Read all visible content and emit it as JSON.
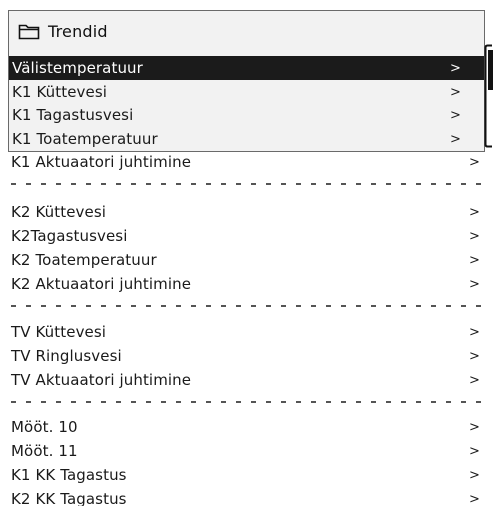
{
  "window": {
    "title": "Trendid",
    "icon": "folder-icon"
  },
  "menu": [
    {
      "label": "Välistemperatuur",
      "selected": true
    },
    {
      "label": "K1 Küttevesi"
    },
    {
      "label": "K1 Tagastusvesi"
    },
    {
      "label": "K1 Toatemperatuur"
    },
    {
      "label": "K1 Aktuaatori juhtimine"
    },
    {
      "label": "K2 Küttevesi"
    },
    {
      "label": "K2Tagastusvesi"
    },
    {
      "label": "K2 Toatemperatuur"
    },
    {
      "label": "K2 Aktuaatori juhtimine"
    },
    {
      "label": "TV Küttevesi"
    },
    {
      "label": "TV Ringlusvesi"
    },
    {
      "label": "TV Aktuaatori juhtimine"
    },
    {
      "label": "Mööt. 10"
    },
    {
      "label": "Mööt. 11"
    },
    {
      "label": "K1 KK Tagastus"
    },
    {
      "label": "K2 KK Tagastus"
    }
  ],
  "arrow_glyph": ">",
  "colors": {
    "selected_bg": "#1b1b1b",
    "panel_bg": "#f2f2f2",
    "text": "#1a1a1a"
  }
}
